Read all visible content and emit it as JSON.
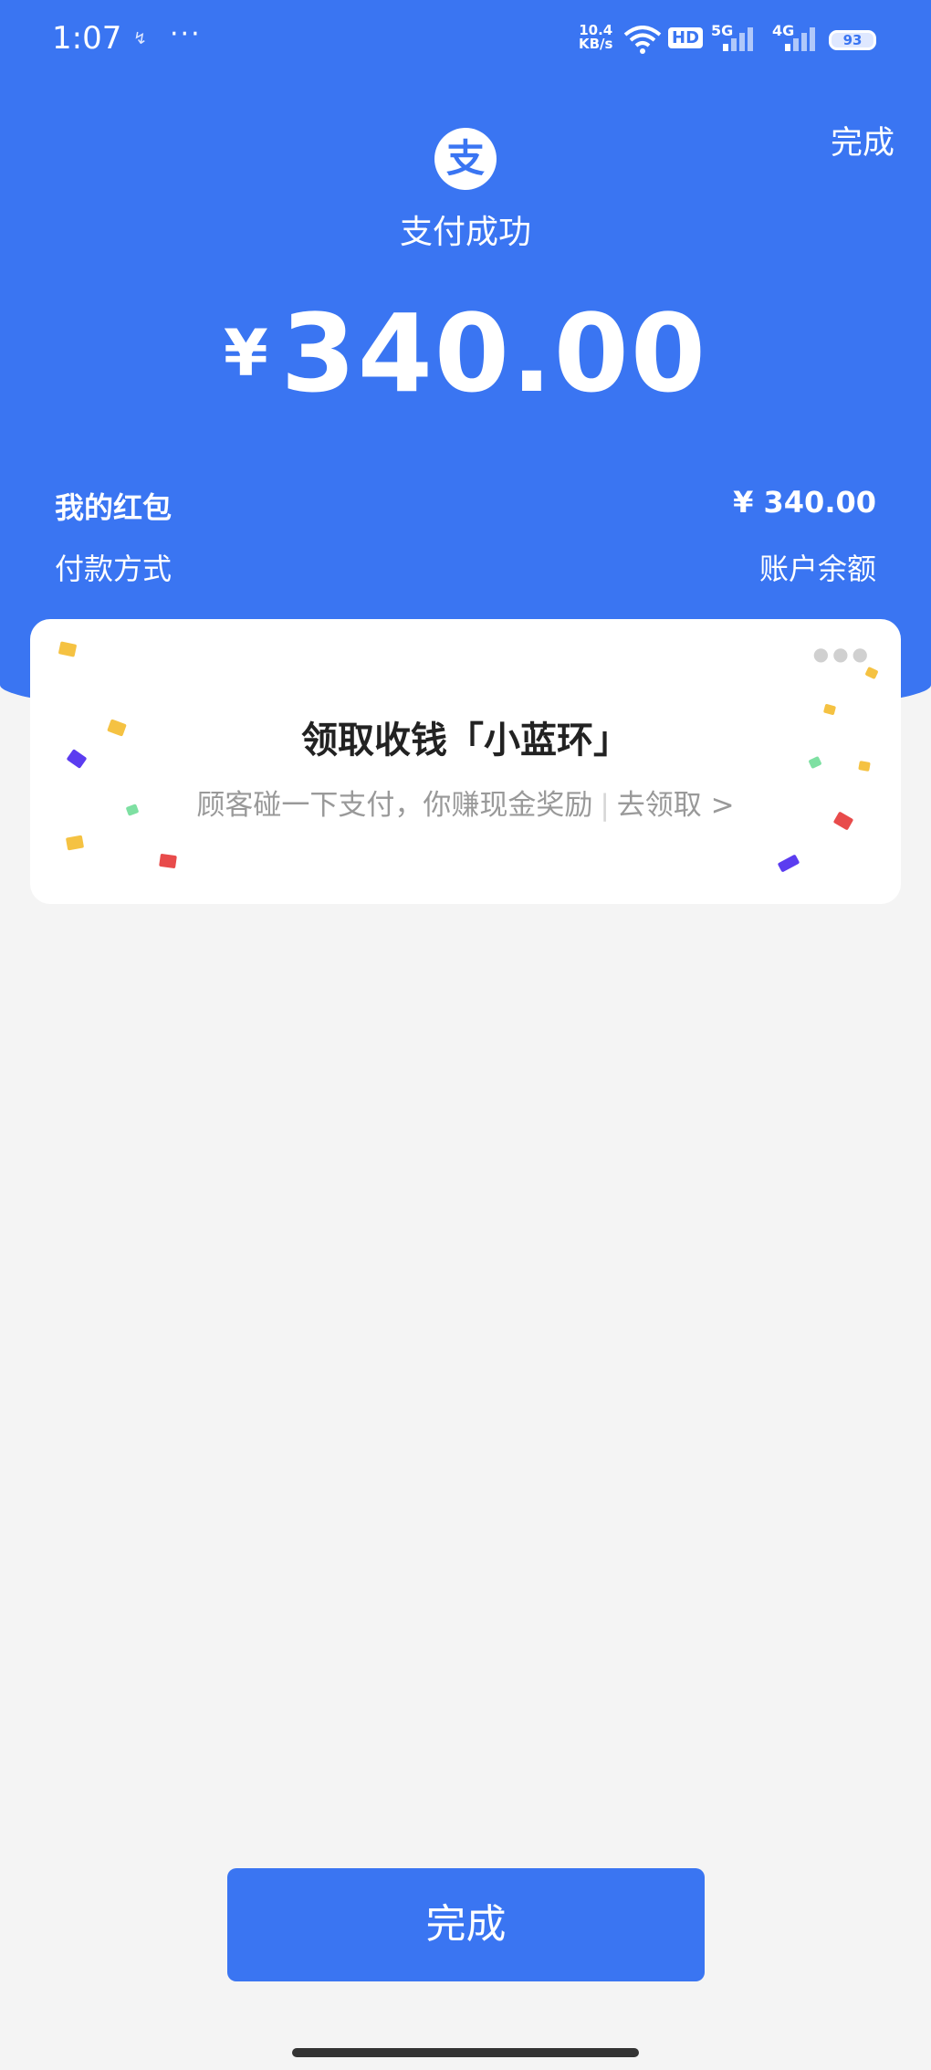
{
  "status_bar": {
    "time": "1:07",
    "notification_glyph": "↯",
    "more_dots": "···",
    "net_speed_value": "10.4",
    "net_speed_unit": "KB/s",
    "hd_label": "HD",
    "sim1_label": "5G",
    "sim2_label": "4G",
    "battery": "93",
    "icons": [
      "wifi-icon",
      "signal-bars-icon",
      "battery-icon"
    ]
  },
  "header": {
    "done_label": "完成",
    "logo_char": "支",
    "payment_status": "支付成功",
    "currency": "¥",
    "amount": "340.00",
    "accent_color": "#3a75f2"
  },
  "details": {
    "row1_label": "我的红包",
    "row1_value": "¥ 340.00",
    "row2_label": "付款方式",
    "row2_value": "账户余额"
  },
  "promo": {
    "title": "领取收钱「小蓝环」",
    "subtitle": "顾客碰一下支付，你赚现金奖励",
    "separator": "|",
    "link": "去领取",
    "chevron": ">"
  },
  "footer": {
    "done_button_label": "完成"
  }
}
